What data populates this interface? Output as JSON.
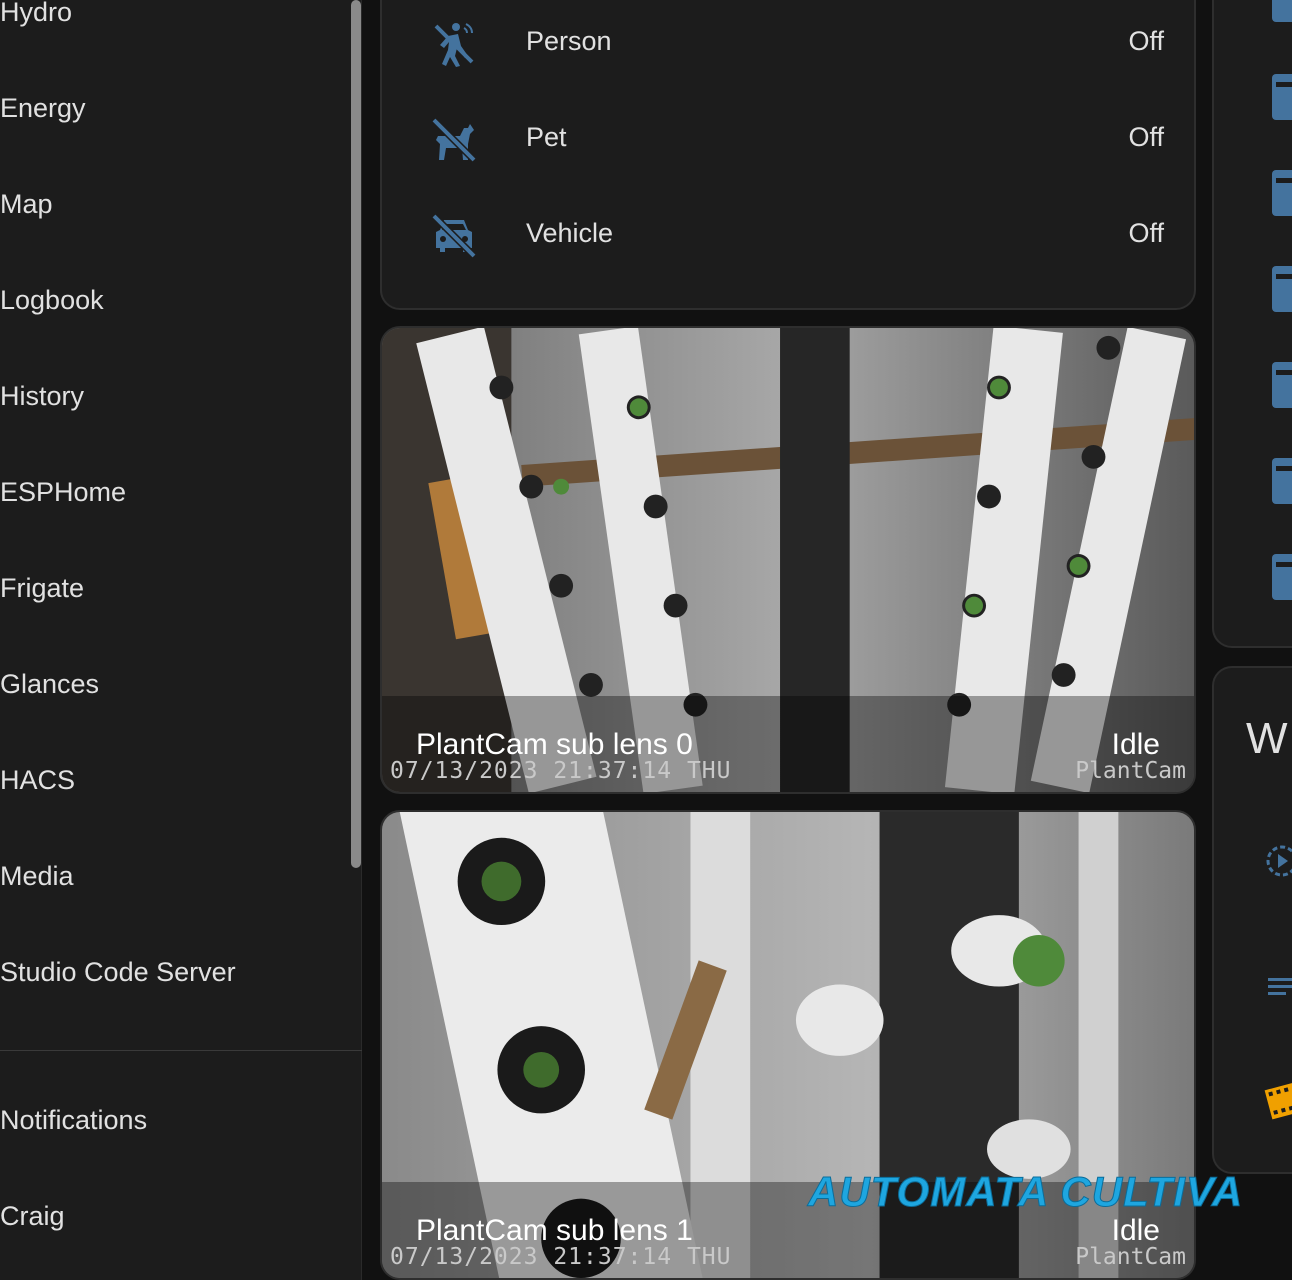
{
  "sidebar": {
    "items": [
      {
        "label": "Hydro",
        "icon": "hydro-icon"
      },
      {
        "label": "Energy",
        "icon": "energy-icon"
      },
      {
        "label": "Map",
        "icon": "map-icon"
      },
      {
        "label": "Logbook",
        "icon": "logbook-icon"
      },
      {
        "label": "History",
        "icon": "history-icon"
      },
      {
        "label": "ESPHome",
        "icon": "esphome-icon"
      },
      {
        "label": "Frigate",
        "icon": "frigate-icon"
      },
      {
        "label": "Glances",
        "icon": "glances-icon"
      },
      {
        "label": "HACS",
        "icon": "hacs-icon"
      },
      {
        "label": "Media",
        "icon": "media-icon"
      },
      {
        "label": "Studio Code Server",
        "icon": "code-icon"
      }
    ],
    "bottom_items": [
      {
        "label": "Notifications",
        "icon": "bell-icon"
      },
      {
        "label": "Craig",
        "icon": "user-icon"
      }
    ]
  },
  "entities": [
    {
      "name": "Person",
      "state": "Off",
      "icon": "person-off-icon"
    },
    {
      "name": "Pet",
      "state": "Off",
      "icon": "pet-off-icon"
    },
    {
      "name": "Vehicle",
      "state": "Off",
      "icon": "vehicle-off-icon"
    }
  ],
  "cameras": [
    {
      "name": "PlantCam sub lens 0",
      "state": "Idle",
      "timestamp": "07/13/2023 21:37:14 THU",
      "brand": "PlantCam"
    },
    {
      "name": "PlantCam sub lens 1",
      "state": "Idle",
      "timestamp": "07/13/2023 21:37:14 THU",
      "brand": "PlantCam"
    }
  ],
  "watermark": "AUTOMATA CULTIVA",
  "right_panel": {
    "heading_fragment": "W",
    "icons": [
      "play-circle-icon",
      "list-icon",
      "film-icon"
    ]
  },
  "colors": {
    "background": "#111111",
    "card": "#1c1c1c",
    "icon_blue": "#44739e",
    "watermark": "#1ea6e0",
    "film_orange": "#f0a000"
  }
}
